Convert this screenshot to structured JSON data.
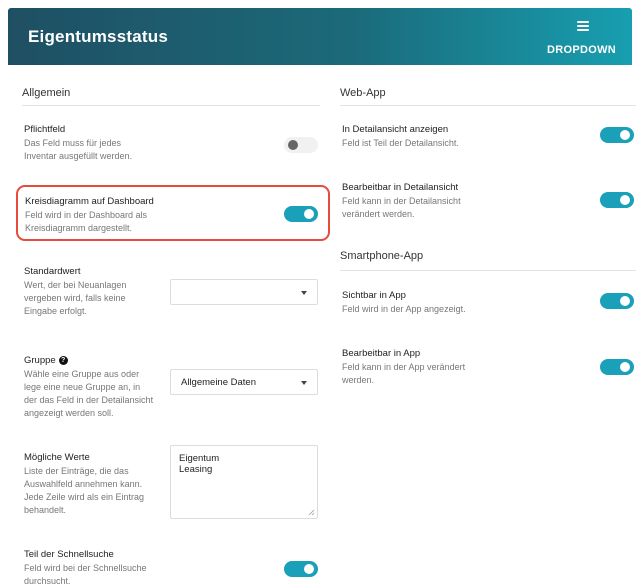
{
  "header": {
    "title": "Eigentumsstatus",
    "menu_label": "DROPDOWN",
    "menu_icon": "menu-icon"
  },
  "left": {
    "heading": "Allgemein",
    "pflichtfeld": {
      "title": "Pflichtfeld",
      "desc1": "Das Feld muss für jedes",
      "desc2": "Inventar ausgefüllt werden.",
      "enabled": false
    },
    "kreisdiagramm": {
      "title": "Kreisdiagramm auf Dashboard",
      "desc1": "Feld wird in der Dashboard als",
      "desc2": "Kreisdiagramm dargestellt.",
      "enabled": true
    },
    "standardwert": {
      "title": "Standardwert",
      "desc1": "Wert, der bei Neuanlagen",
      "desc2": "vergeben wird, falls keine",
      "desc3": "Eingabe erfolgt.",
      "value": ""
    },
    "gruppe": {
      "title": "Gruppe",
      "help_icon": "help-icon",
      "help_glyph": "?",
      "desc1": "Wähle eine Gruppe aus oder",
      "desc2": "lege eine neue Gruppe an, in",
      "desc3": "der das Feld in der Detailansicht",
      "desc4": "angezeigt werden soll.",
      "value": "Allgemeine Daten"
    },
    "moegliche_werte": {
      "title": "Mögliche Werte",
      "desc1": "Liste der Einträge, die das",
      "desc2": "Auswahlfeld annehmen kann.",
      "desc3": "Jede Zeile wird als ein Eintrag",
      "desc4": "behandelt.",
      "values": [
        "Eigentum",
        "Leasing"
      ]
    },
    "schnellsuche": {
      "title": "Teil der Schnellsuche",
      "desc1": "Feld wird bei der Schnellsuche",
      "desc2": "durchsucht.",
      "enabled": true
    }
  },
  "right": {
    "webapp_heading": "Web-App",
    "detailansicht": {
      "title": "In Detailansicht anzeigen",
      "desc1": "Feld ist Teil der Detailansicht.",
      "enabled": true
    },
    "bearbeitbar_detail": {
      "title": "Bearbeitbar in Detailansicht",
      "desc1": "Feld kann in der Detailansicht",
      "desc2": "verändert werden.",
      "enabled": true
    },
    "smartphone_heading": "Smartphone-App",
    "sichtbar_app": {
      "title": "Sichtbar in App",
      "desc1": "Feld wird in der App angezeigt.",
      "enabled": true
    },
    "bearbeitbar_app": {
      "title": "Bearbeitbar in App",
      "desc1": "Feld kann in der App verändert",
      "desc2": "werden.",
      "enabled": true
    }
  },
  "colors": {
    "accent": "#1aa0b8",
    "highlight": "#e64b3c",
    "header_start": "#1f4f63",
    "header_end": "#179fb0"
  }
}
